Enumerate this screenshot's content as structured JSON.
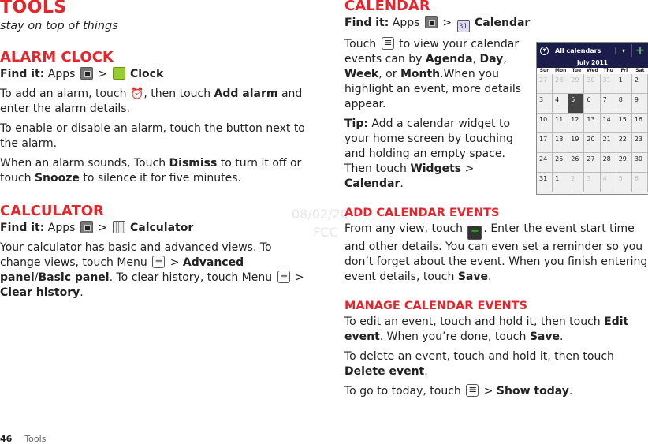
{
  "left": {
    "title": "Tools",
    "subtitle": "stay on top of things",
    "alarm": {
      "heading": "Alarm clock",
      "find_label": "Find it:",
      "find_apps": "Apps",
      "sep": ">",
      "find_target": "Clock",
      "p1a": "To add an alarm, touch",
      "p1b": ", then touch",
      "p1c": "Add alarm",
      "p1d": "and enter the alarm details.",
      "p2": "To enable or disable an alarm, touch the button next to the alarm.",
      "p3a": "When an alarm sounds, Touch",
      "p3b": "Dismiss",
      "p3c": "to turn it off or touch",
      "p3d": "Snooze",
      "p3e": "to silence it for five minutes."
    },
    "calculator": {
      "heading": "Calculator",
      "find_label": "Find it:",
      "find_apps": "Apps",
      "sep": ">",
      "find_target": "Calculator",
      "p1a": "Your calculator has basic and advanced views. To change views, touch Menu",
      "p1b": ">",
      "p1c": "Advanced panel",
      "p1d": "/",
      "p1e": "Basic panel",
      "p1f": ". To clear history, touch Menu",
      "p1g": ">",
      "p1h": "Clear history",
      "p1i": "."
    }
  },
  "right": {
    "heading": "Calendar",
    "find_label": "Find it:",
    "find_apps": "Apps",
    "sep": ">",
    "find_target": "Calendar",
    "cal_icon": "31",
    "p1a": "Touch",
    "p1b": "to view your calendar events can by",
    "agenda": "Agenda",
    "day": "Day",
    "week": "Week",
    "or": "or",
    "month": "Month",
    "p1c": ".When you highlight an event, more details appear.",
    "tip_label": "Tip:",
    "tip_a": "Add a calendar widget to your home screen by touching and holding an empty space. Then touch",
    "widgets": "Widgets",
    "gt": ">",
    "calendar": "Calendar",
    "dot": ".",
    "add": {
      "heading": "Add calendar events",
      "p_a": "From any view, touch",
      "p_b": ". Enter the event start time and other details. You can even set a reminder so you don’t forget about the event. When you finish entering event details, touch",
      "save": "Save",
      "end": "."
    },
    "manage": {
      "heading": "Manage calendar events",
      "p1a": "To edit an event, touch and hold it, then touch",
      "p1b": "Edit event",
      "p1c": ". When you’re done, touch",
      "p1d": "Save",
      "p1e": ".",
      "p2a": "To delete an event, touch and hold it, then touch",
      "p2b": "Delete event",
      "p2c": ".",
      "p3a": "To go to today, touch",
      "p3b": ">",
      "p3c": "Show today",
      "p3d": "."
    }
  },
  "widget": {
    "title": "All calendars",
    "month": "July 2011",
    "days": [
      "Sun",
      "Mon",
      "Tue",
      "Wed",
      "Thu",
      "Fri",
      "Sat"
    ],
    "dates": [
      "27",
      "28",
      "29",
      "30",
      "31",
      "1",
      "2",
      "3",
      "4",
      "5",
      "6",
      "7",
      "8",
      "9",
      "10",
      "11",
      "12",
      "13",
      "14",
      "15",
      "16",
      "17",
      "18",
      "19",
      "20",
      "21",
      "22",
      "23",
      "24",
      "25",
      "26",
      "27",
      "28",
      "29",
      "30",
      "31",
      "1",
      "2",
      "3",
      "4",
      "5",
      "6"
    ],
    "today": "5",
    "accent": "#e4262c"
  },
  "watermark": {
    "date": "08/02/20",
    "fcc": "FCC"
  },
  "footer": {
    "page": "46",
    "section": "Tools"
  }
}
